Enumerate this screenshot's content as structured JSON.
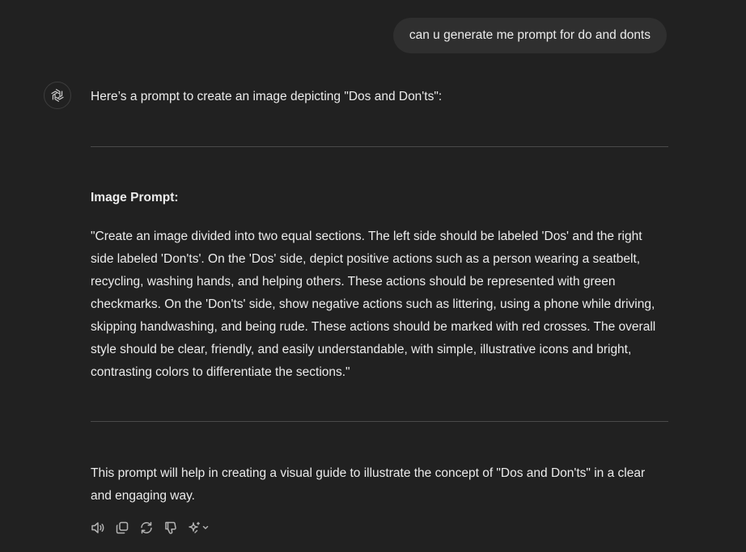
{
  "user_message": "can u generate me prompt for do and donts",
  "assistant": {
    "intro": "Here’s a prompt to create an image depicting \"Dos and Don'ts\":",
    "heading": "Image Prompt:",
    "prompt_text": "\"Create an image divided into two equal sections. The left side should be labeled 'Dos' and the right side labeled 'Don'ts'. On the 'Dos' side, depict positive actions such as a person wearing a seatbelt, recycling, washing hands, and helping others. These actions should be represented with green checkmarks. On the 'Don'ts' side, show negative actions such as littering, using a phone while driving, skipping handwashing, and being rude. These actions should be marked with red crosses. The overall style should be clear, friendly, and easily understandable, with simple, illustrative icons and bright, contrasting colors to differentiate the sections.\"",
    "outro": "This prompt will help in creating a visual guide to illustrate the concept of \"Dos and Don'ts\" in a clear and engaging way."
  },
  "action_icons": [
    "read-aloud-icon",
    "copy-icon",
    "regenerate-icon",
    "thumbs-down-icon",
    "change-model-icon"
  ],
  "colors": {
    "background": "#212121",
    "user_bubble": "#2f2f2f",
    "text": "#ececec",
    "divider": "#4a4a4a",
    "icon": "#b4b4b4"
  }
}
